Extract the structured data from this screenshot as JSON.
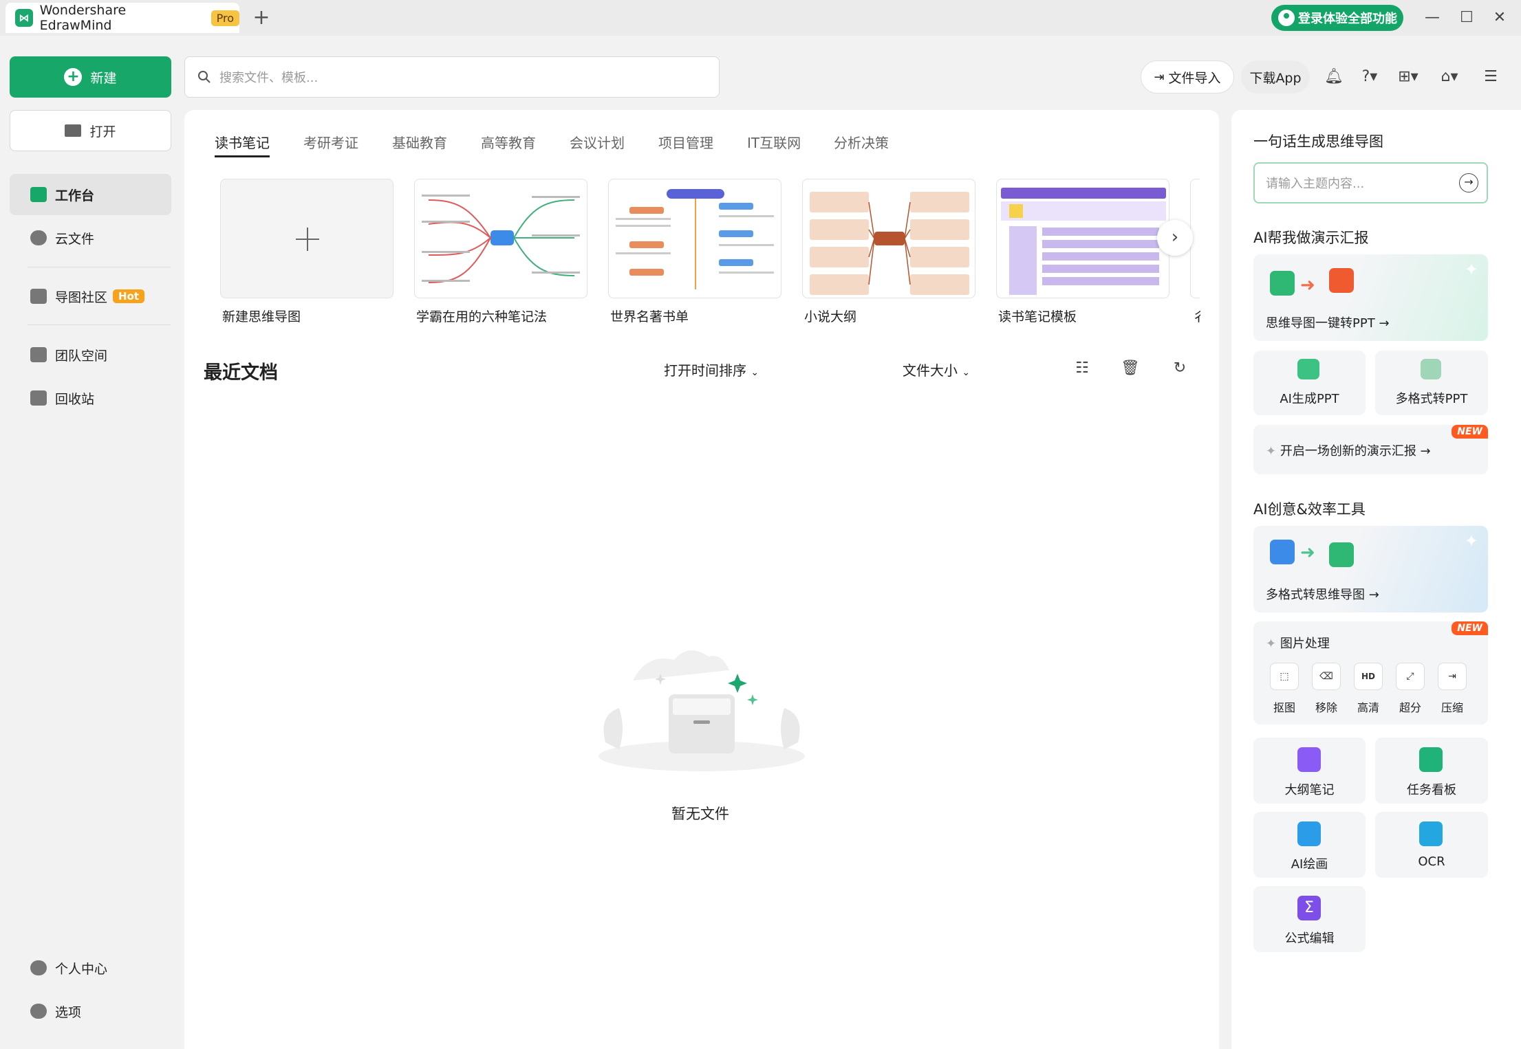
{
  "window": {
    "app_logo_text": "⋈",
    "title": "Wondershare EdrawMind",
    "badge": "Pro",
    "new_tab": "+",
    "login_button": "登录体验全部功能",
    "minimize": "—",
    "maximize": "☐",
    "close": "✕"
  },
  "toolbar": {
    "new_label": "新建",
    "open_label": "打开",
    "search_placeholder": "搜索文件、模板...",
    "import_label": "文件导入",
    "download_label": "下载App"
  },
  "sidebar": {
    "items": [
      {
        "label": "工作台"
      },
      {
        "label": "云文件"
      },
      {
        "label": "导图社区",
        "badge": "Hot"
      },
      {
        "label": "团队空间"
      },
      {
        "label": "回收站"
      }
    ],
    "bottom": [
      {
        "label": "个人中心"
      },
      {
        "label": "选项"
      }
    ]
  },
  "categories": [
    "读书笔记",
    "考研考证",
    "基础教育",
    "高等教育",
    "会议计划",
    "项目管理",
    "IT互联网",
    "分析决策"
  ],
  "templates": [
    {
      "label": "新建思维导图"
    },
    {
      "label": "学霸在用的六种笔记法"
    },
    {
      "label": "世界名著书单"
    },
    {
      "label": "小说大纲"
    },
    {
      "label": "读书笔记模板"
    },
    {
      "label": "彳"
    }
  ],
  "recent": {
    "title": "最近文档",
    "sort_time": "打开时间排序",
    "sort_size": "文件大小",
    "empty": "暂无文件"
  },
  "right": {
    "gen_title": "一句话生成思维导图",
    "gen_placeholder": "请输入主题内容...",
    "ppt_title": "AI帮我做演示汇报",
    "mind_to_ppt": "思维导图一键转PPT",
    "ai_ppt": "AI生成PPT",
    "multi_ppt": "多格式转PPT",
    "present": "开启一场创新的演示汇报",
    "tools_title": "AI创意&效率工具",
    "multi_mind": "多格式转思维导图",
    "image_proc": "图片处理",
    "new_badge": "NEW",
    "img_tools": [
      "抠图",
      "移除",
      "高清",
      "超分",
      "压缩"
    ],
    "tools": [
      "大纲笔记",
      "任务看板",
      "AI绘画",
      "OCR",
      "公式编辑"
    ]
  },
  "colors": {
    "accent": "#17a869",
    "hot": "#f6a21a",
    "new": "#ff5a1f"
  }
}
